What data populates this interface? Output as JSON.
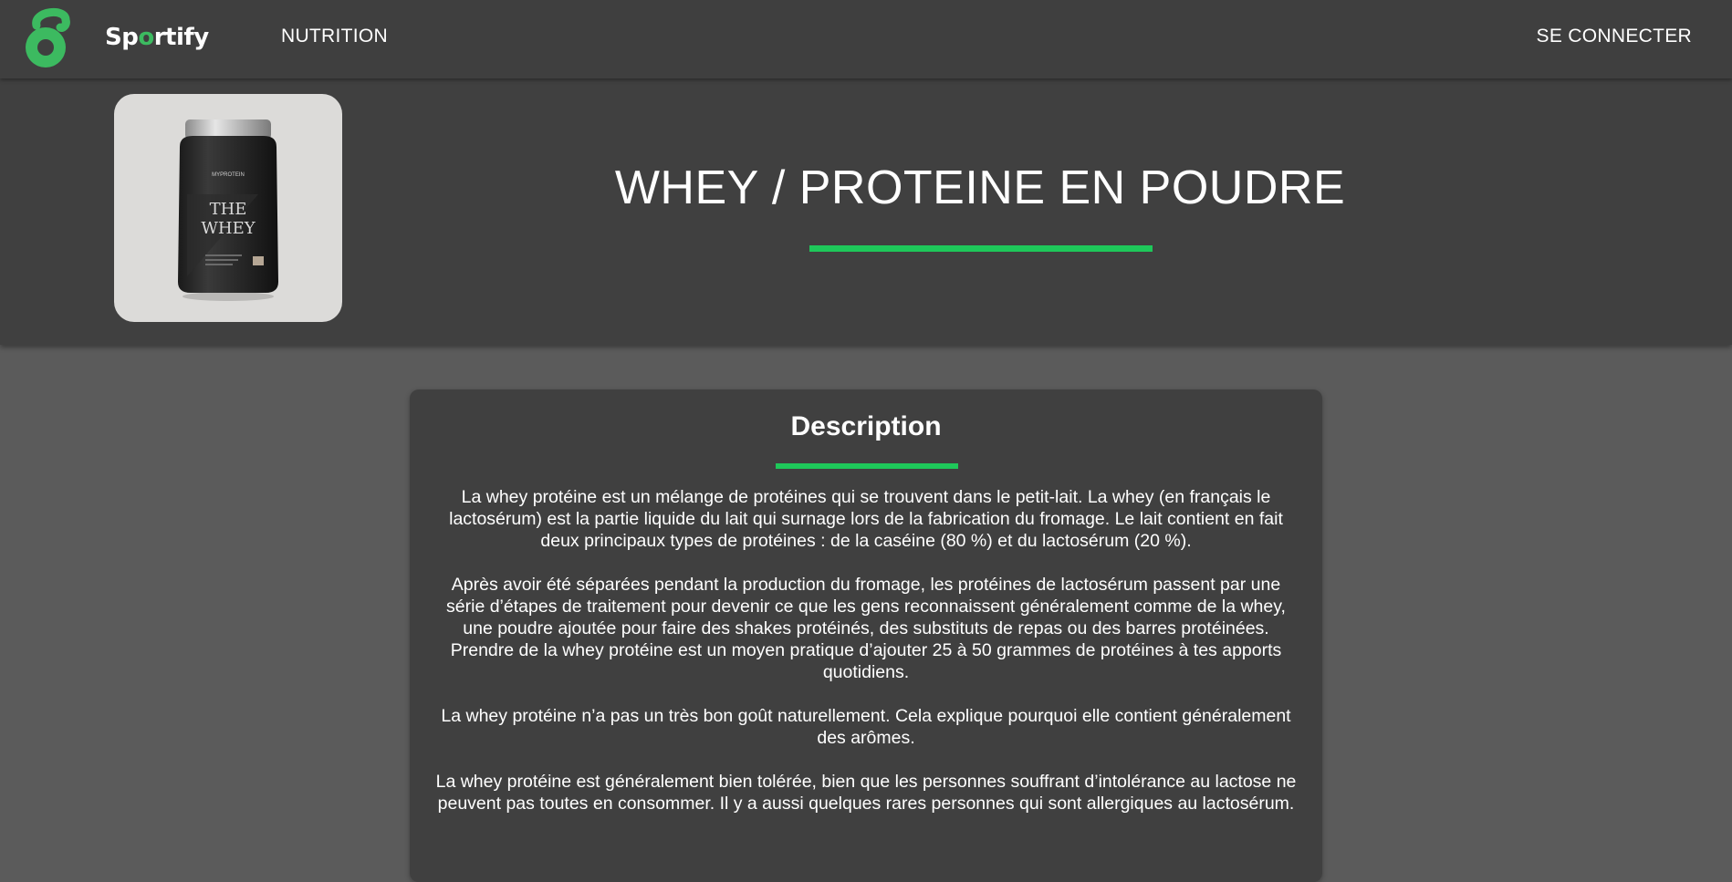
{
  "navbar": {
    "brand_prefix": "Sp",
    "brand_o": "o",
    "brand_suffix": "rtify",
    "logo_icon": "kettlebell-icon",
    "nutrition_label": "NUTRITION",
    "login_label": "SE CONNECTER",
    "accent_color": "#3cba60"
  },
  "hero": {
    "title": "WHEY / PROTEINE EN POUDRE",
    "product_image_icon": "protein-jar-image",
    "jar_brand": "MYPROTEIN",
    "jar_title_line1": "THE",
    "jar_title_line2": "WHEY",
    "accent_color": "#1ec85a"
  },
  "description": {
    "title": "Description",
    "paragraphs": [
      "La whey protéine est un mélange de protéines qui se trouvent dans le petit-lait. La whey (en français le lactosérum) est la partie liquide du lait qui surnage lors de la fabrication du fromage. Le lait contient en fait deux principaux types de protéines : de la caséine (80 %) et du lactosérum (20 %).",
      "Après avoir été séparées pendant la production du fromage, les protéines de lactosérum passent par une série d’étapes de traitement pour devenir ce que les gens reconnaissent généralement comme de la whey, une poudre ajoutée pour faire des shakes protéinés, des substituts de repas ou des barres protéinées. Prendre de la whey protéine est un moyen pratique d’ajouter 25 à 50 grammes de protéines à tes apports quotidiens.",
      "La whey protéine n’a pas un très bon goût naturellement. Cela explique pourquoi elle contient généralement des arômes.",
      "La whey protéine est généralement bien tolérée, bien que les personnes souffrant d’intolérance au lactose ne peuvent pas toutes en consommer. Il y a aussi quelques rares personnes qui sont allergiques au lactosérum."
    ]
  }
}
